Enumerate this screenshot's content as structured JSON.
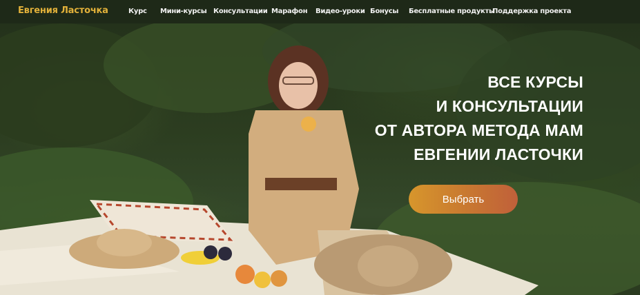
{
  "header": {
    "brand": "Евгения Ласточка",
    "nav": [
      {
        "label": "Курс"
      },
      {
        "label": "Мини-курсы"
      },
      {
        "label": "Консультации"
      },
      {
        "label": "Марафон"
      },
      {
        "label": "Видео-уроки"
      },
      {
        "label": "Бонусы"
      },
      {
        "label": "Бесплатные продукты"
      },
      {
        "label": "Поддержка проекта"
      }
    ]
  },
  "hero": {
    "headline_lines": [
      "ВСЕ  КУРСЫ",
      "И КОНСУЛЬТАЦИИ",
      "ОТ АВТОРА МЕТОДА МАМ",
      "ЕВГЕНИИ ЛАСТОЧКИ"
    ],
    "cta_label": "Выбрать"
  },
  "colors": {
    "nav_background": "#1e2918",
    "brand": "#e2b13a",
    "cta_start": "#d7962c",
    "cta_end": "#c0603a"
  }
}
